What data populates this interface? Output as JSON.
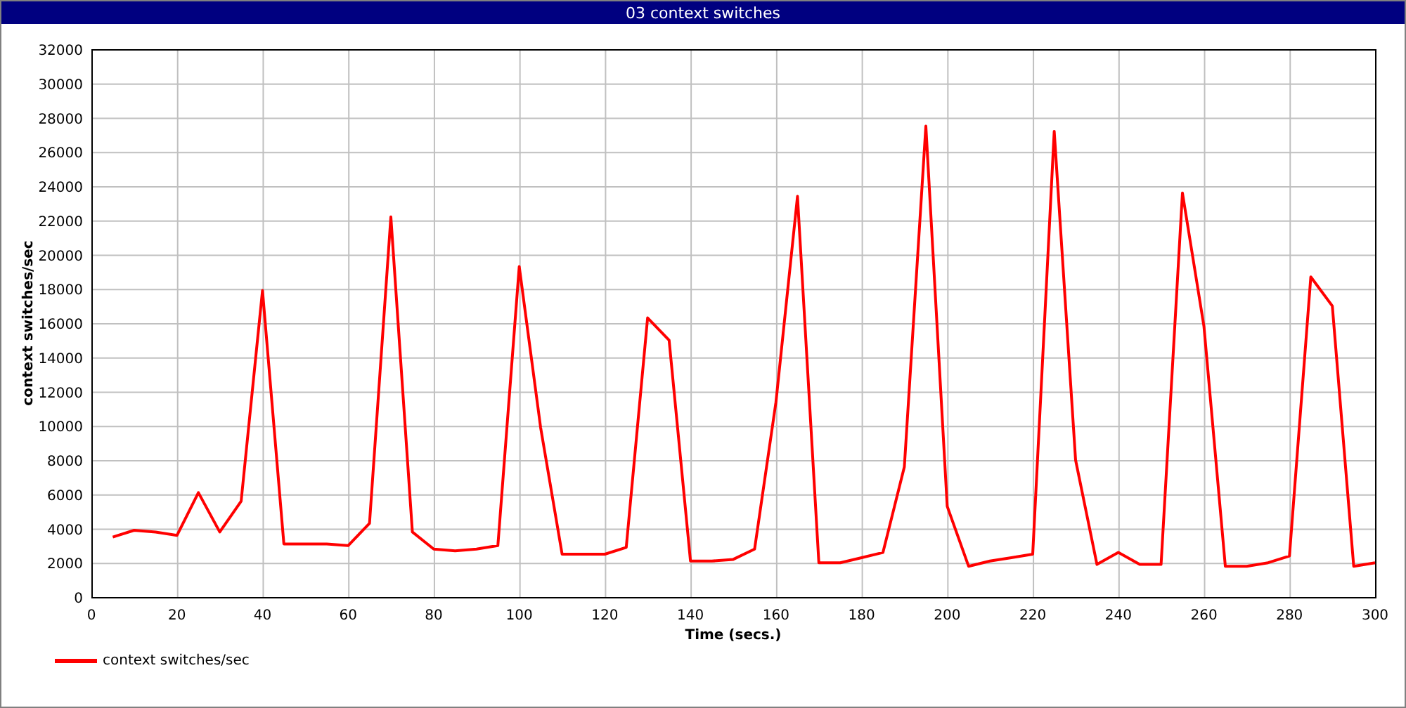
{
  "window": {
    "title": "03 context switches"
  },
  "chart": {
    "chart_data": {
      "type": "line",
      "grid": true,
      "xlabel": "Time (secs.)",
      "ylabel": "context switches/sec",
      "xlim": [
        0,
        300
      ],
      "ylim": [
        0,
        32000
      ],
      "xticks": [
        0,
        20,
        40,
        60,
        80,
        100,
        120,
        140,
        160,
        180,
        200,
        220,
        240,
        260,
        280,
        300
      ],
      "yticks": [
        0,
        2000,
        4000,
        6000,
        8000,
        10000,
        12000,
        14000,
        16000,
        18000,
        20000,
        22000,
        24000,
        26000,
        28000,
        30000,
        32000
      ],
      "x": [
        5,
        10,
        15,
        20,
        25,
        30,
        35,
        40,
        45,
        50,
        55,
        60,
        65,
        70,
        75,
        80,
        85,
        90,
        95,
        100,
        105,
        110,
        115,
        120,
        125,
        130,
        135,
        140,
        145,
        150,
        155,
        160,
        165,
        170,
        175,
        180,
        185,
        190,
        195,
        200,
        205,
        210,
        215,
        220,
        225,
        230,
        235,
        240,
        245,
        250,
        255,
        260,
        265,
        270,
        275,
        280,
        285,
        290,
        295,
        300
      ],
      "series": [
        {
          "name": "context switches/sec",
          "color": "#ff0000",
          "values": [
            3500,
            3900,
            3800,
            3600,
            6100,
            3800,
            5600,
            17900,
            3100,
            3100,
            3100,
            3000,
            4300,
            22200,
            3800,
            2800,
            2700,
            2800,
            3000,
            19300,
            9900,
            2500,
            2500,
            2500,
            2900,
            16300,
            15000,
            2100,
            2100,
            2200,
            2800,
            11400,
            23400,
            2000,
            2000,
            2300,
            2600,
            7600,
            27500,
            5300,
            1800,
            2100,
            2300,
            2500,
            27200,
            8000,
            1900,
            2600,
            1900,
            1900,
            23600,
            15800,
            1800,
            1800,
            2000,
            2400,
            18700,
            17000,
            1800,
            2000
          ]
        }
      ]
    }
  }
}
